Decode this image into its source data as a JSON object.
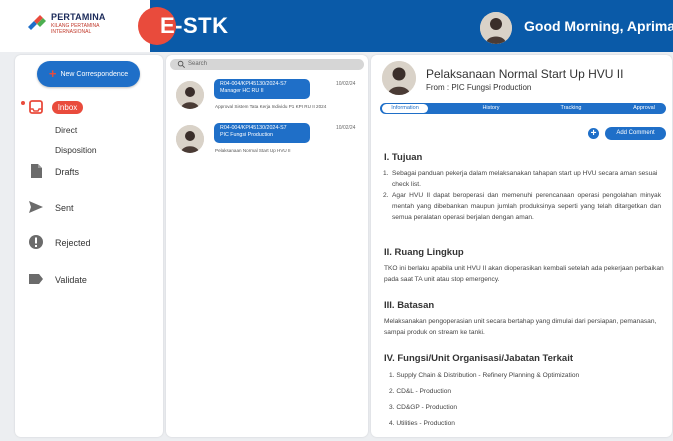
{
  "header": {
    "logo_title": "PERTAMINA",
    "logo_subtitle": "KILANG PERTAMINA INTERNASIONAL",
    "app_name": "E-STK",
    "greeting": "Good Morning, Aprimal"
  },
  "sidebar": {
    "new_button_label": "New Correspondence",
    "inbox_label": "Inbox",
    "inbox_sub": [
      "Direct",
      "Disposition"
    ],
    "items": [
      {
        "label": "Drafts",
        "icon": "document-icon"
      },
      {
        "label": "Sent",
        "icon": "send-icon"
      },
      {
        "label": "Rejected",
        "icon": "alert-icon"
      },
      {
        "label": "Validate",
        "icon": "label-icon"
      }
    ]
  },
  "list": {
    "search_placeholder": "Search",
    "items": [
      {
        "code": "R04-004/KPI45130/2024-S7",
        "sender": "Manager HC RU II",
        "date": "10/02/24",
        "desc": "Approval Sistem Tata Kerja Individu P1 KPI RU II 2024"
      },
      {
        "code": "R04-004/KPI45130/2024-S7",
        "sender": "PIC Fungsi Production",
        "date": "10/02/24",
        "desc": "Pelaksanaan Normal Start Up HVU II"
      }
    ]
  },
  "detail": {
    "title": "Pelaksanaan Normal Start Up HVU II",
    "from": "From : PIC Fungsi Production",
    "tabs": [
      "Information",
      "History",
      "Tracking",
      "Approval"
    ],
    "add_comment_label": "Add Comment",
    "sections": {
      "tujuan": {
        "heading": "I. Tujuan",
        "items": [
          "Sebagai panduan pekerja dalam melaksanakan tahapan start up HVU secara aman sesuai check list.",
          "Agar HVU II dapat beroperasi dan memenuhi perencanaan operasi pengolahan minyak mentah yang dibebankan maupun jumlah produksinya seperti yang telah ditargetkan dan semua peralatan operasi berjalan dengan aman."
        ]
      },
      "ruang_lingkup": {
        "heading": "II. Ruang Lingkup",
        "text": "TKO ini berlaku apabila unit HVU II akan dioperasikan kembali setelah ada pekerjaan perbaikan pada saat TA unit atau stop emergency."
      },
      "batasan": {
        "heading": "III. Batasan",
        "text": "Melaksanakan pengoperasian unit secara bertahap yang dimulai dari persiapan, pemanasan, sampai produk on stream ke tanki."
      },
      "fungsi": {
        "heading": "IV. Fungsi/Unit Organisasi/Jabatan Terkait",
        "items": [
          "1. Supply Chain & Distribution - Refinery Planning & Optimization",
          "2. CD&L - Production",
          "3. CD&GP - Production",
          "4. Utilities - Production"
        ]
      }
    }
  },
  "colors": {
    "primary": "#1f6fc8",
    "header": "#0a5aa8",
    "accent": "#e94b3c"
  }
}
